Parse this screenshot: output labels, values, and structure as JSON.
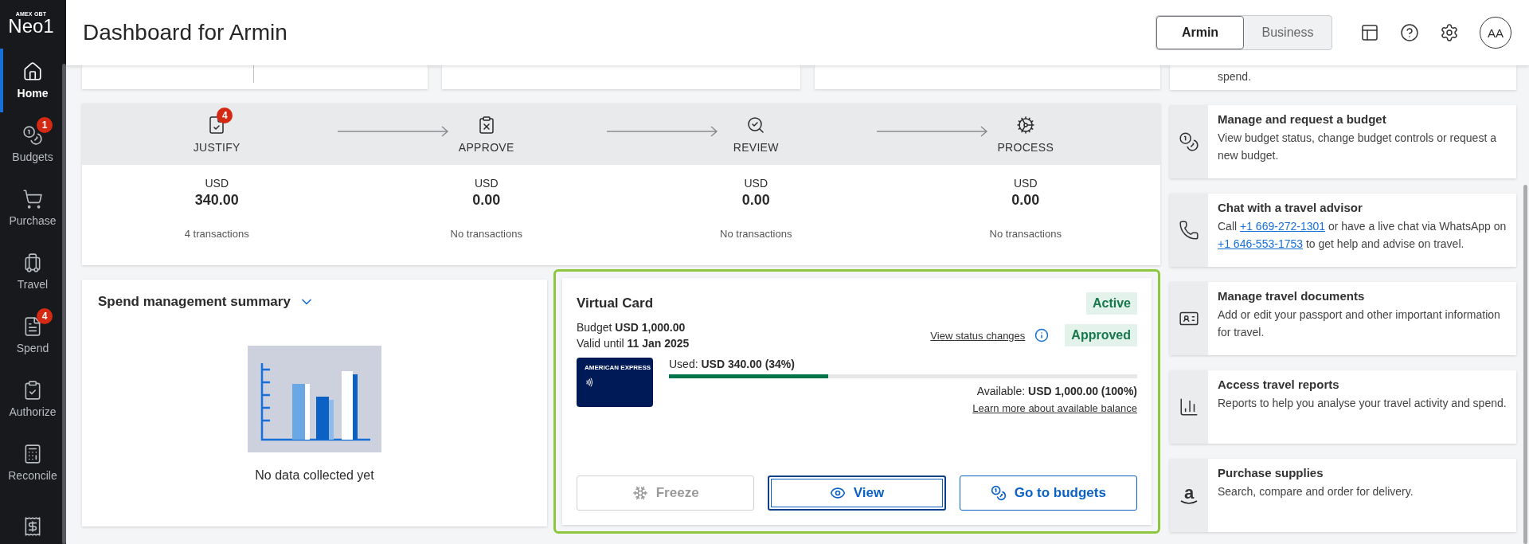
{
  "sidebar": {
    "logo_small": "AMEX GBT",
    "logo_main": "Neo1",
    "items": [
      {
        "label": "Home",
        "selected": true
      },
      {
        "label": "Budgets",
        "selected": false,
        "badge": "1"
      },
      {
        "label": "Purchase",
        "selected": false
      },
      {
        "label": "Travel",
        "selected": false
      },
      {
        "label": "Spend",
        "selected": false,
        "badge": "4"
      },
      {
        "label": "Authorize",
        "selected": false
      },
      {
        "label": "Reconcile",
        "selected": false
      },
      {
        "selected": false
      }
    ]
  },
  "header": {
    "title": "Dashboard for Armin",
    "toggle": [
      {
        "label": "Armin",
        "selected": true
      },
      {
        "label": "Business",
        "selected": false
      }
    ],
    "avatar": "AA"
  },
  "top_cards": [
    {
      "divided": true
    },
    {
      "divided": false
    },
    {
      "divided": false
    }
  ],
  "pipeline": {
    "stages": [
      {
        "label": "JUSTIFY",
        "badge": "4",
        "currency": "USD",
        "amount": "340.00",
        "count": "4 transactions"
      },
      {
        "label": "APPROVE",
        "currency": "USD",
        "amount": "0.00",
        "count": "No transactions"
      },
      {
        "label": "REVIEW",
        "currency": "USD",
        "amount": "0.00",
        "count": "No transactions"
      },
      {
        "label": "PROCESS",
        "currency": "USD",
        "amount": "0.00",
        "count": "No transactions"
      }
    ]
  },
  "spend_summary": {
    "title": "Spend management summary",
    "expanded": false,
    "empty_text": "No data collected yet"
  },
  "virtual_card": {
    "highlighted": true,
    "title": "Virtual Card",
    "status_badges": [
      "Active",
      "Approved"
    ],
    "budget": "Budget **USD 1,000.00**",
    "valid": "Valid until **11 Jan 2025**",
    "status_link": "View status changes",
    "card_brand": "AMERICAN EXPRESS",
    "used": "Used: **USD 340.00 (34%)**",
    "level": 0.34,
    "available": "Available: **USD 1,000.00 (100%)**",
    "balance_link": "Learn more about available balance",
    "buttons": [
      {
        "label": "Freeze",
        "disabled": true,
        "focused": false
      },
      {
        "label": "View",
        "disabled": false,
        "focused": true
      },
      {
        "label": "Go to budgets",
        "disabled": false,
        "focused": false
      }
    ]
  },
  "quick_links": [
    {
      "parts": [
        {
          "kind": "text",
          "text": "spend."
        }
      ]
    },
    {
      "title": "Manage and request a budget",
      "parts": [
        {
          "kind": "text",
          "text": "View budget status, change budget controls or request a new budget."
        }
      ]
    },
    {
      "title": "Chat with a travel advisor",
      "parts": [
        {
          "kind": "text",
          "text": "Call "
        },
        {
          "kind": "link",
          "text": "+1 669-272-1301"
        },
        {
          "kind": "text",
          "text": " or have a live chat via WhatsApp on "
        },
        {
          "kind": "link",
          "text": "+1 646-553-1753"
        },
        {
          "kind": "text",
          "text": " to get help and advise on travel."
        }
      ]
    },
    {
      "title": "Manage travel documents",
      "parts": [
        {
          "kind": "text",
          "text": "Add or edit your passport and other important information for travel."
        }
      ]
    },
    {
      "title": "Access travel reports",
      "parts": [
        {
          "kind": "text",
          "text": "Reports to help you analyse your travel activity and spend."
        }
      ]
    },
    {
      "title": "Purchase supplies",
      "logo_text": "a",
      "parts": [
        {
          "kind": "text",
          "text": "Search, compare and order for delivery."
        }
      ]
    }
  ]
}
